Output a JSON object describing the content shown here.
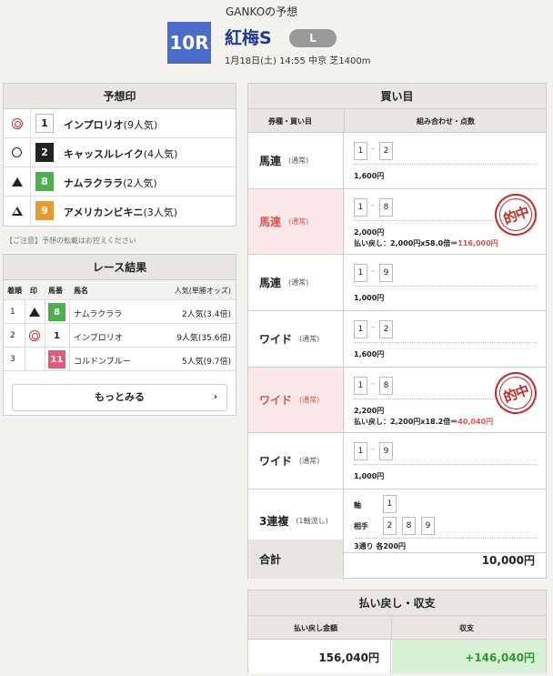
{
  "header": {
    "expert_title": "GANKOの予想",
    "race_number": "10R",
    "race_name": "紅梅S",
    "grade": "L",
    "race_meta": "1月18日(土) 14:55 中京 芝1400m"
  },
  "predictions": {
    "title": "予想印",
    "rows": [
      {
        "mark": "double-circle-icon",
        "number": "1",
        "horse": "インプロリオ",
        "popularity": "(9人気)",
        "num_bg": "#ffffff",
        "num_fg": "#222222"
      },
      {
        "mark": "circle-icon",
        "number": "2",
        "horse": "キャッスルレイク",
        "popularity": "(4人気)",
        "num_bg": "#222222",
        "num_fg": "#ffffff"
      },
      {
        "mark": "filled-triangle-icon",
        "number": "8",
        "horse": "ナムラクララ",
        "popularity": "(2人気)",
        "num_bg": "#4caf50",
        "num_fg": "#ffffff"
      },
      {
        "mark": "open-triangle-icon",
        "number": "9",
        "horse": "アメリカンビキニ",
        "popularity": "(3人気)",
        "num_bg": "#e89a2c",
        "num_fg": "#ffffff"
      }
    ],
    "notice": "【ご注意】予想の転載はお控えください"
  },
  "results": {
    "title": "レース結果",
    "headers": {
      "rank": "着順",
      "mark": "印",
      "number": "馬番",
      "name": "馬名",
      "popularity": "人気(単勝オッズ)"
    },
    "rows": [
      {
        "rank": "1",
        "mark": "filled-triangle-icon",
        "number": "8",
        "name": "ナムラクララ",
        "popularity": "2人気(3.4倍)",
        "num_bg": "#4caf50",
        "num_fg": "#ffffff"
      },
      {
        "rank": "2",
        "mark": "double-circle-icon",
        "number": "1",
        "name": "インプロリオ",
        "popularity": "9人気(35.6倍)",
        "num_bg": "#ffffff",
        "num_fg": "#222222"
      },
      {
        "rank": "3",
        "mark": "",
        "number": "11",
        "name": "コルドンブルー",
        "popularity": "5人気(9.7倍)",
        "num_bg": "#e05a7a",
        "num_fg": "#ffffff"
      }
    ],
    "more_label": "もっとみる",
    "more_icon": "chevron-right-icon"
  },
  "bets": {
    "title": "買い目",
    "headers": {
      "type": "券種・買い目",
      "combo": "組み合わせ・点数"
    },
    "rows": [
      {
        "type": "馬連",
        "method": "(通常)",
        "nums": [
          "1",
          "2"
        ],
        "amount": "1,600円",
        "hit": false
      },
      {
        "type": "馬連",
        "method": "(通常)",
        "nums": [
          "1",
          "8"
        ],
        "amount": "2,000円",
        "hit": true,
        "payout_label": "払い戻し",
        "payout_calc": "：2,000円x58.0倍＝",
        "payout_amount": "116,000円",
        "stamp": "的中"
      },
      {
        "type": "馬連",
        "method": "(通常)",
        "nums": [
          "1",
          "9"
        ],
        "amount": "1,000円",
        "hit": false
      },
      {
        "type": "ワイド",
        "method": "(通常)",
        "nums": [
          "1",
          "2"
        ],
        "amount": "1,600円",
        "hit": false
      },
      {
        "type": "ワイド",
        "method": "(通常)",
        "nums": [
          "1",
          "8"
        ],
        "amount": "2,200円",
        "hit": true,
        "payout_label": "払い戻し",
        "payout_calc": "：2,200円x18.2倍＝",
        "payout_amount": "40,040円",
        "stamp": "的中"
      },
      {
        "type": "ワイド",
        "method": "(通常)",
        "nums": [
          "1",
          "9"
        ],
        "amount": "1,000円",
        "hit": false
      }
    ],
    "formation": {
      "type": "3連複",
      "method": "(1軸流し)",
      "axis_label": "軸",
      "axis": [
        "1"
      ],
      "partner_label": "相手",
      "partners": [
        "2",
        "8",
        "9"
      ],
      "summary": "3通り 各200円"
    },
    "total_label": "合計",
    "total_value": "10,000円"
  },
  "returns": {
    "title": "払い戻し・収支",
    "payout_header": "払い戻し金額",
    "profit_header": "収支",
    "payout_value": "156,040円",
    "profit_value": "+146,040円",
    "profit_color": "#2e9a2e"
  }
}
